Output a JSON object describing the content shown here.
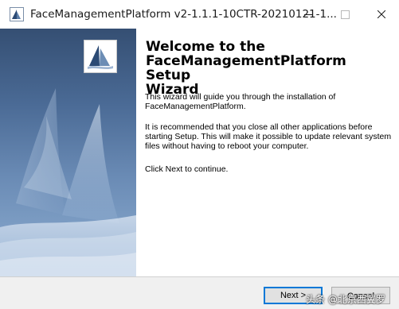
{
  "window": {
    "title": "FaceManagementPlatform v2-1.1.1-10CTR-20210121-1..."
  },
  "wizard": {
    "heading_line1": "Welcome to the",
    "heading_line2": "FaceManagementPlatform Setup",
    "heading_line3": "Wizard",
    "intro": "This wizard will guide you through the installation of FaceManagementPlatform.",
    "recommendation": "It is recommended that you close all other applications before starting Setup. This will make it possible to update relevant system files without having to reboot your computer.",
    "continue_hint": "Click Next to continue."
  },
  "buttons": {
    "next": "Next >",
    "cancel": "Cancel"
  },
  "watermark": "头条 @北京西翼罗",
  "colors": {
    "banner_top": "#354f73",
    "banner_bottom": "#8fafd2",
    "focus_border": "#0078d7"
  },
  "icons": {
    "app": "installer-icon",
    "logo": "installer-logo-icon",
    "banner": "sail-graphic"
  }
}
